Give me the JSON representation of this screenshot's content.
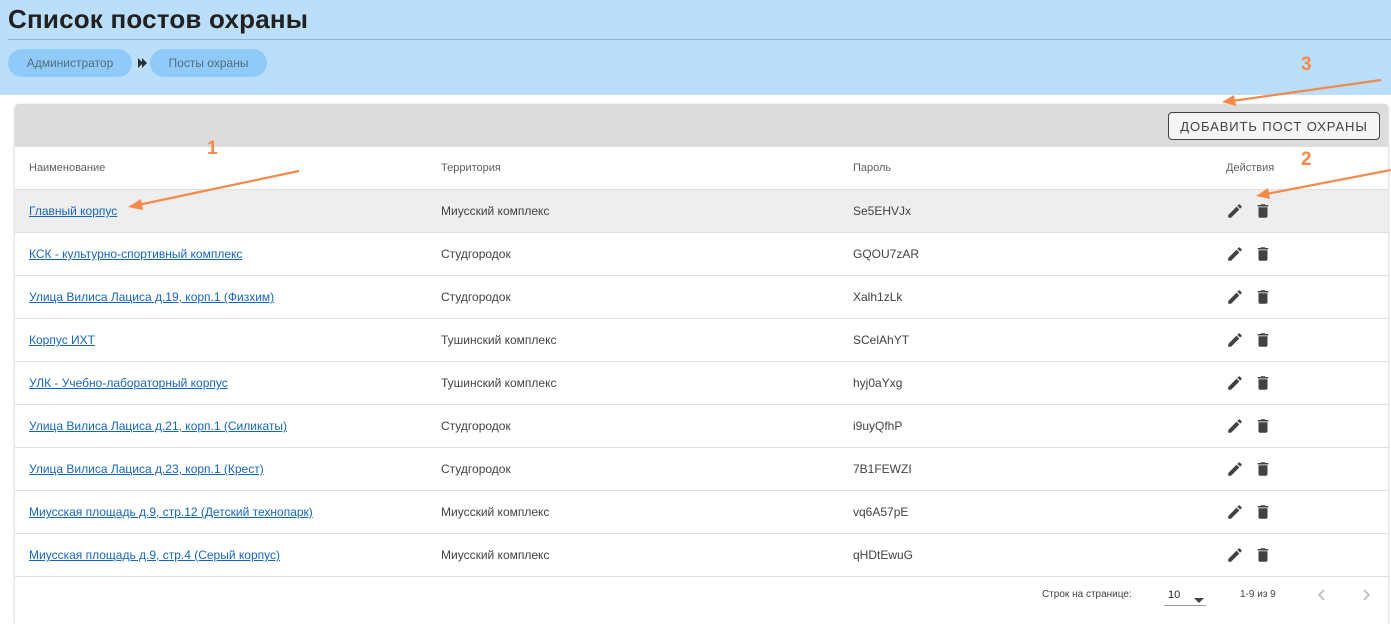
{
  "page": {
    "title": "Список постов охраны"
  },
  "breadcrumb": {
    "items": [
      "Администратор",
      "Посты охраны"
    ],
    "separator": "›"
  },
  "toolbar": {
    "add_label": "ДОБАВИТЬ ПОСТ ОХРАНЫ"
  },
  "table": {
    "headers": {
      "name": "Наименование",
      "territory": "Территория",
      "password": "Пароль",
      "actions": "Действия"
    },
    "rows": [
      {
        "name": "Главный корпус",
        "territory": "Миусский комплекс",
        "password": "Se5EHVJx"
      },
      {
        "name": "КСК - культурно-спортивный комплекс",
        "territory": "Студгородок",
        "password": "GQOU7zAR"
      },
      {
        "name": "Улица Вилиса Лациса д.19, корп.1 (Физхим)",
        "territory": "Студгородок",
        "password": "Xalh1zLk"
      },
      {
        "name": "Корпус ИХТ",
        "territory": "Тушинский комплекс",
        "password": "SCelAhYT"
      },
      {
        "name": "УЛК - Учебно-лабораторный корпус",
        "territory": "Тушинский комплекс",
        "password": "hyj0aYxg"
      },
      {
        "name": "Улица Вилиса Лациса д.21, корп.1 (Силикаты)",
        "territory": "Студгородок",
        "password": "i9uyQfhP"
      },
      {
        "name": "Улица Вилиса Лациса д.23, корп.1 (Крест)",
        "territory": "Студгородок",
        "password": "7B1FEWZI"
      },
      {
        "name": "Миусская площадь д.9, стр.12 (Детский технопарк)",
        "territory": "Миусский комплекс",
        "password": "vq6A57pE"
      },
      {
        "name": "Миусская площадь д.9, стр.4 (Серый корпус)",
        "territory": "Миусский комплекс",
        "password": "qHDtEwuG"
      }
    ],
    "row_icons": [
      "pencil-icon",
      "trash-icon"
    ]
  },
  "pagination": {
    "rows_label": "Строк на странице:",
    "rows_value": "10",
    "range": "1-9 из 9"
  },
  "annotations": {
    "a1": "1",
    "a2": "2",
    "a3": "3"
  },
  "colors": {
    "header_bg": "#bbdefb",
    "breadcrumb_pill": "#90caf9",
    "link": "#1565c0",
    "annotation": "#f4894a",
    "toolbar_bg": "#dcdcdc"
  }
}
